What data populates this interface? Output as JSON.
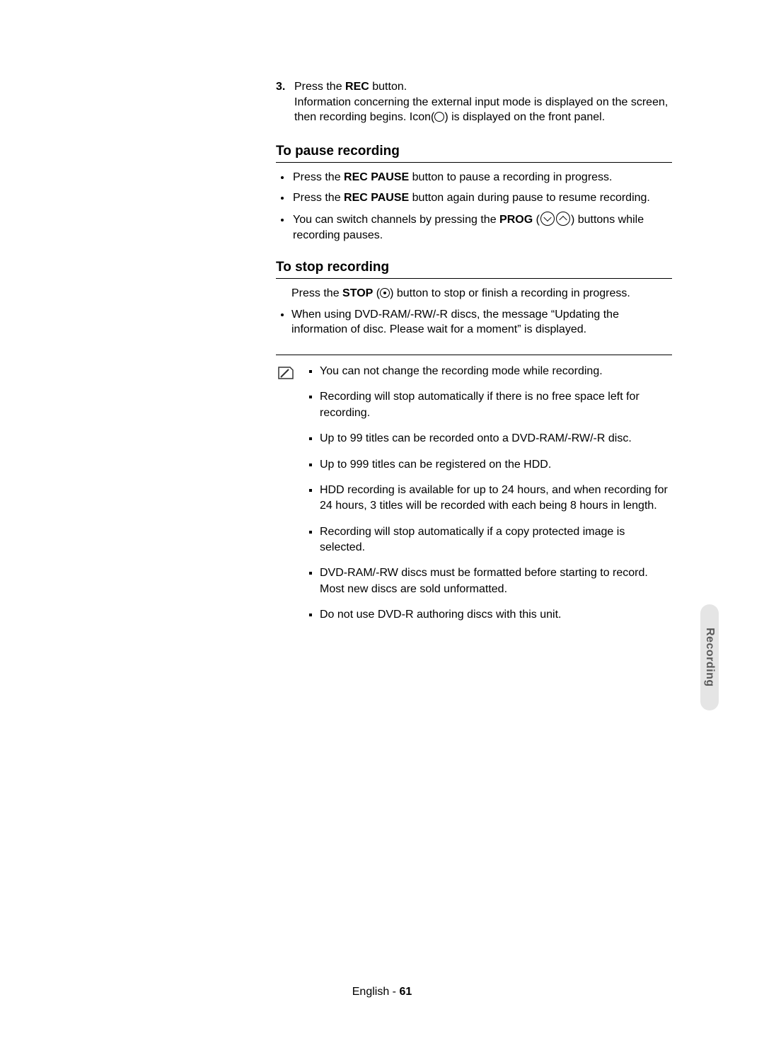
{
  "step3": {
    "number": "3.",
    "line1_pre": "Press the ",
    "line1_bold": "REC",
    "line1_post": " button.",
    "line2": "Information concerning the external input mode is displayed on the screen, then recording begins. Icon(   ) is displayed on the front panel."
  },
  "pause": {
    "heading": "To pause recording",
    "b1_pre": "Press the ",
    "b1_bold": "REC PAUSE",
    "b1_post": " button to pause a recording in progress.",
    "b2_pre": "Press the ",
    "b2_bold": "REC PAUSE",
    "b2_post": " button again during pause to resume recording.",
    "b3_pre": "You can switch channels by pressing the ",
    "b3_bold": "PROG",
    "b3_post": " buttons while recording pauses."
  },
  "stop": {
    "heading": "To stop recording",
    "intro_pre": "Press the ",
    "intro_bold": "STOP",
    "intro_post": " button to stop or finish a recording in progress.",
    "b1": "When using DVD-RAM/-RW/-R discs, the message “Updating the information of disc. Please wait for a moment” is displayed."
  },
  "notes": {
    "n1": "You can not change the recording mode while recording.",
    "n2": "Recording will stop automatically if there is no free space left for recording.",
    "n3": "Up to 99 titles can be recorded onto a DVD-RAM/-RW/-R disc.",
    "n4": "Up to 999 titles can be registered on the HDD.",
    "n5": "HDD recording is available for up to 24 hours, and when recording for 24 hours, 3 titles will be recorded with each being 8 hours in length.",
    "n6": "Recording will stop automatically if a copy protected image is selected.",
    "n7": "DVD-RAM/-RW discs must be  formatted before starting to record. Most new discs are sold unformatted.",
    "n8": "Do not use DVD-R authoring discs with this unit."
  },
  "sideTab": "Recording",
  "footer": {
    "lang": "English - ",
    "page": "61"
  }
}
